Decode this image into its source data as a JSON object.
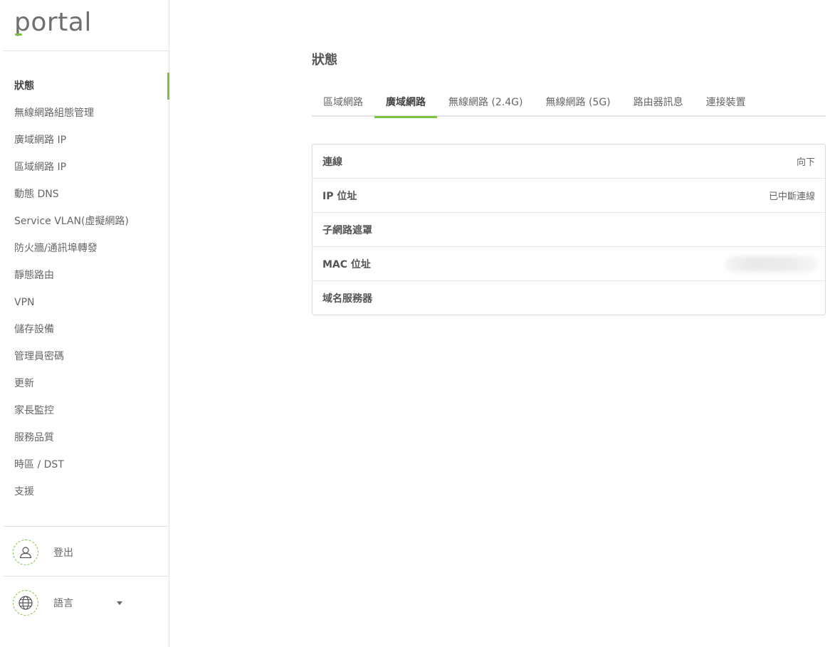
{
  "brand": {
    "logo_text": "portal",
    "accent_color": "#7cc242"
  },
  "sidebar": {
    "items": [
      {
        "label": "狀態",
        "active": true
      },
      {
        "label": "無線網路組態管理"
      },
      {
        "label": "廣域網路 IP"
      },
      {
        "label": "區域網路 IP"
      },
      {
        "label": "動態 DNS"
      },
      {
        "label": "Service VLAN(虛擬網路)"
      },
      {
        "label": "防火牆/通訊埠轉發"
      },
      {
        "label": "靜態路由"
      },
      {
        "label": "VPN"
      },
      {
        "label": "儲存設備"
      },
      {
        "label": "管理員密碼"
      },
      {
        "label": "更新"
      },
      {
        "label": "家長監控"
      },
      {
        "label": "服務品質"
      },
      {
        "label": "時區 / DST"
      },
      {
        "label": "支援"
      }
    ],
    "logout_label": "登出",
    "language_label": "語言"
  },
  "main": {
    "title": "狀態",
    "tabs": [
      {
        "label": "區域網路"
      },
      {
        "label": "廣域網路",
        "active": true
      },
      {
        "label": "無線網路 (2.4G)"
      },
      {
        "label": "無線網路 (5G)"
      },
      {
        "label": "路由器訊息"
      },
      {
        "label": "連接裝置"
      }
    ],
    "rows": [
      {
        "label": "連線",
        "value": "向下"
      },
      {
        "label": "IP 位址",
        "value": "已中斷連線"
      },
      {
        "label": "子網路遮罩",
        "value": ""
      },
      {
        "label": "MAC 位址",
        "value": ""
      },
      {
        "label": "域名服務器",
        "value": ""
      }
    ]
  }
}
